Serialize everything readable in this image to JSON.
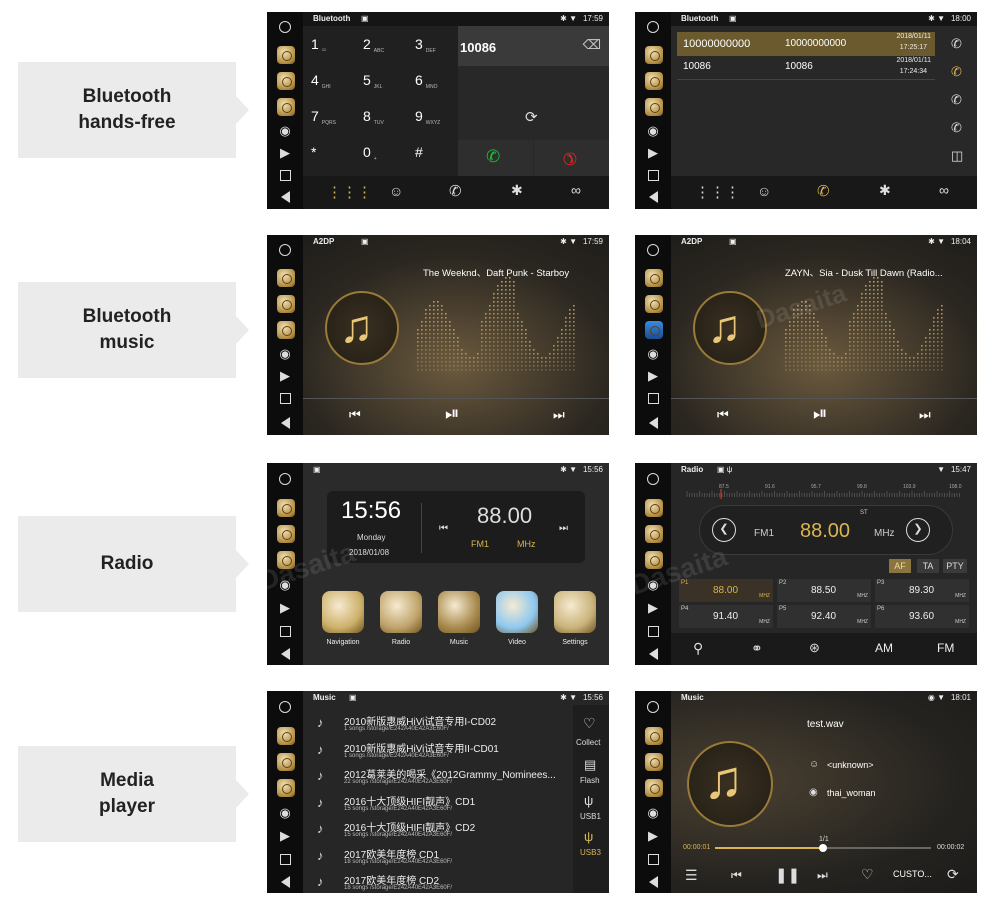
{
  "labels": {
    "handsfree": "Bluetooth\nhands-free",
    "music": "Bluetooth\nmusic",
    "radio": "Radio",
    "media": "Media\nplayer"
  },
  "bt_dial": {
    "title": "Bluetooth",
    "time": "17:59",
    "number": "10086",
    "keys": [
      {
        "d": "1",
        "s": "ထ"
      },
      {
        "d": "2",
        "s": "ABC"
      },
      {
        "d": "3",
        "s": "DEF"
      },
      {
        "d": "4",
        "s": "GHI"
      },
      {
        "d": "5",
        "s": "JKL"
      },
      {
        "d": "6",
        "s": "MNO"
      },
      {
        "d": "7",
        "s": "PQRS"
      },
      {
        "d": "8",
        "s": "TUV"
      },
      {
        "d": "9",
        "s": "WXYZ"
      },
      {
        "d": "*",
        "s": ""
      },
      {
        "d": "0",
        "s": "+"
      },
      {
        "d": "#",
        "s": ""
      }
    ]
  },
  "bt_log": {
    "title": "Bluetooth",
    "time": "18:00",
    "rows": [
      {
        "name": "10000000000",
        "number": "10000000000",
        "date": "2018/01/11",
        "time": "17:25:17"
      },
      {
        "name": "10086",
        "number": "10086",
        "date": "2018/01/11",
        "time": "17:24:34"
      }
    ]
  },
  "a2dp1": {
    "title": "A2DP",
    "time": "17:59",
    "track": "The Weeknd、Daft Punk - Starboy"
  },
  "a2dp2": {
    "title": "A2DP",
    "time": "18:04",
    "track": "ZAYN、Sia - Dusk Till Dawn (Radio..."
  },
  "home": {
    "time": "15:56",
    "clock": "15:56",
    "day": "Monday",
    "date": "2018/01/08",
    "freq": "88.00",
    "band": "FM1",
    "unit": "MHz",
    "apps": [
      "Navigation",
      "Radio",
      "Music",
      "Video",
      "Settings"
    ]
  },
  "radio": {
    "title": "Radio",
    "time": "15:47",
    "scale": [
      "87.5",
      "91.6",
      "95.7",
      "99.8",
      "103.9",
      "108.0"
    ],
    "band": "FM1",
    "freq": "88.00",
    "unit": "MHz",
    "st": "ST",
    "flags": [
      "AF",
      "TA",
      "PTY"
    ],
    "presets": [
      {
        "p": "P1",
        "f": "88.00",
        "u": "MHZ"
      },
      {
        "p": "P2",
        "f": "88.50",
        "u": "MHZ"
      },
      {
        "p": "P3",
        "f": "89.30",
        "u": "MHZ"
      },
      {
        "p": "P4",
        "f": "91.40",
        "u": "MHZ"
      },
      {
        "p": "P5",
        "f": "92.40",
        "u": "MHZ"
      },
      {
        "p": "P6",
        "f": "93.60",
        "u": "MHZ"
      }
    ],
    "bottom": {
      "am": "AM",
      "fm": "FM"
    }
  },
  "music_list": {
    "title": "Music",
    "time": "15:56",
    "items": [
      {
        "t": "2010新版惠威HiVi试音专用I-CD02",
        "s": "1 songs /storage/E242A40E42A3E60F/"
      },
      {
        "t": "2010新版惠威HiVi试音专用II-CD01",
        "s": "1 songs /storage/E242A40E42A3E60F/"
      },
      {
        "t": "2012葛莱美的喝采《2012Grammy_Nominees...",
        "s": "22 songs /storage/E242A40E42A3E60F/"
      },
      {
        "t": "2016十大顶级HIFI靓声》CD1",
        "s": "15 songs /storage/E242A40E42A3E60F/"
      },
      {
        "t": "2016十大顶级HIFI靓声》CD2",
        "s": "15 songs /storage/E242A40E42A3E60F/"
      },
      {
        "t": "2017欧美年度榜 CD1",
        "s": "18 songs /storage/E242A40E42A3E60F/"
      },
      {
        "t": "2017欧美年度榜 CD2",
        "s": "18 songs /storage/E242A40E42A3E60F/"
      }
    ],
    "side": [
      "Collect",
      "Flash",
      "USB1",
      "USB3"
    ]
  },
  "player": {
    "title": "Music",
    "time": "18:01",
    "file": "test.wav",
    "artist": "<unknown>",
    "album": "thai_woman",
    "count": "1/1",
    "elapsed": "00:00:01",
    "total": "00:00:02",
    "progress": 0.5,
    "mode": "CUSTO..."
  },
  "watermark": "Dasaita"
}
